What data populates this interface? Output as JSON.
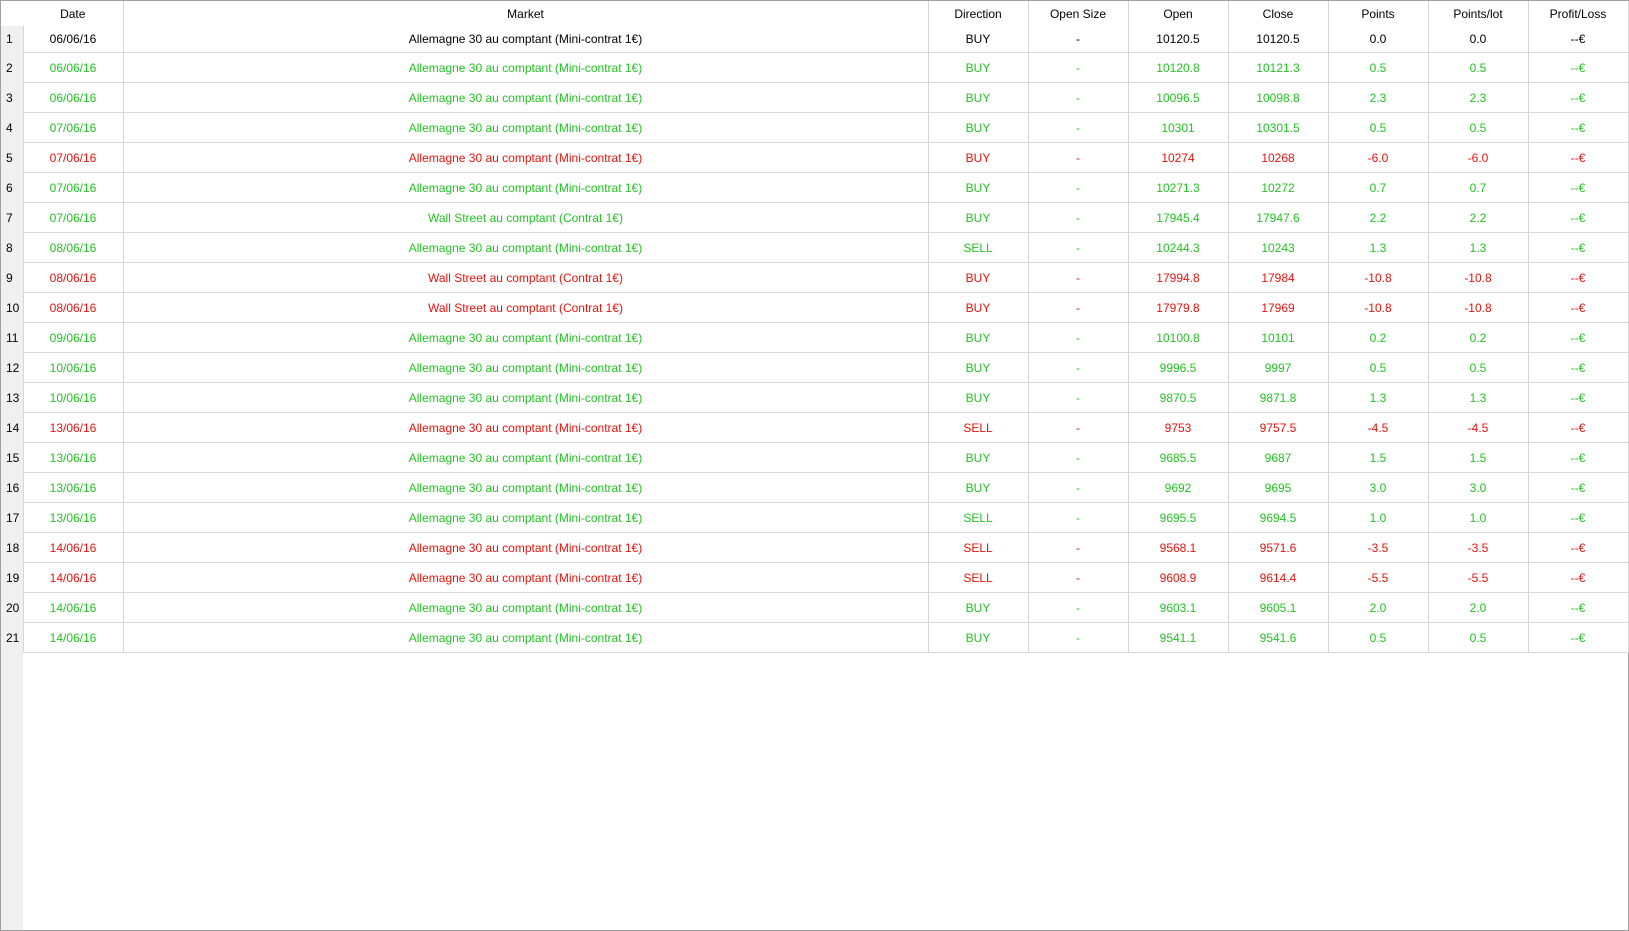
{
  "columns": [
    "Date",
    "Market",
    "Direction",
    "Open Size",
    "Open",
    "Close",
    "Points",
    "Points/lot",
    "Profit/Loss"
  ],
  "colors": {
    "neutral": "#000000",
    "win": "#22c322",
    "loss": "#e8120c"
  },
  "rows": [
    {
      "n": "1",
      "status": "neutral",
      "date": "06/06/16",
      "market": "Allemagne 30 au comptant (Mini-contrat 1€)",
      "direction": "BUY",
      "open_size": "-",
      "open": "10120.5",
      "close": "10120.5",
      "points": "0.0",
      "points_lot": "0.0",
      "pl": "--€"
    },
    {
      "n": "2",
      "status": "win",
      "date": "06/06/16",
      "market": "Allemagne 30 au comptant (Mini-contrat 1€)",
      "direction": "BUY",
      "open_size": "-",
      "open": "10120.8",
      "close": "10121.3",
      "points": "0.5",
      "points_lot": "0.5",
      "pl": "--€"
    },
    {
      "n": "3",
      "status": "win",
      "date": "06/06/16",
      "market": "Allemagne 30 au comptant (Mini-contrat 1€)",
      "direction": "BUY",
      "open_size": "-",
      "open": "10096.5",
      "close": "10098.8",
      "points": "2.3",
      "points_lot": "2.3",
      "pl": "--€"
    },
    {
      "n": "4",
      "status": "win",
      "date": "07/06/16",
      "market": "Allemagne 30 au comptant (Mini-contrat 1€)",
      "direction": "BUY",
      "open_size": "-",
      "open": "10301",
      "close": "10301.5",
      "points": "0.5",
      "points_lot": "0.5",
      "pl": "--€"
    },
    {
      "n": "5",
      "status": "loss",
      "date": "07/06/16",
      "market": "Allemagne 30 au comptant (Mini-contrat 1€)",
      "direction": "BUY",
      "open_size": "-",
      "open": "10274",
      "close": "10268",
      "points": "-6.0",
      "points_lot": "-6.0",
      "pl": "--€"
    },
    {
      "n": "6",
      "status": "win",
      "date": "07/06/16",
      "market": "Allemagne 30 au comptant (Mini-contrat 1€)",
      "direction": "BUY",
      "open_size": "-",
      "open": "10271.3",
      "close": "10272",
      "points": "0.7",
      "points_lot": "0.7",
      "pl": "--€"
    },
    {
      "n": "7",
      "status": "win",
      "date": "07/06/16",
      "market": "Wall Street au comptant (Contrat 1€)",
      "direction": "BUY",
      "open_size": "-",
      "open": "17945.4",
      "close": "17947.6",
      "points": "2.2",
      "points_lot": "2.2",
      "pl": "--€"
    },
    {
      "n": "8",
      "status": "win",
      "date": "08/06/16",
      "market": "Allemagne 30 au comptant (Mini-contrat 1€)",
      "direction": "SELL",
      "open_size": "-",
      "open": "10244.3",
      "close": "10243",
      "points": "1.3",
      "points_lot": "1.3",
      "pl": "--€"
    },
    {
      "n": "9",
      "status": "loss",
      "date": "08/06/16",
      "market": "Wall Street au comptant (Contrat 1€)",
      "direction": "BUY",
      "open_size": "-",
      "open": "17994.8",
      "close": "17984",
      "points": "-10.8",
      "points_lot": "-10.8",
      "pl": "--€"
    },
    {
      "n": "10",
      "status": "loss",
      "date": "08/06/16",
      "market": "Wall Street au comptant (Contrat 1€)",
      "direction": "BUY",
      "open_size": "-",
      "open": "17979.8",
      "close": "17969",
      "points": "-10.8",
      "points_lot": "-10.8",
      "pl": "--€"
    },
    {
      "n": "11",
      "status": "win",
      "date": "09/06/16",
      "market": "Allemagne 30 au comptant (Mini-contrat 1€)",
      "direction": "BUY",
      "open_size": "-",
      "open": "10100.8",
      "close": "10101",
      "points": "0.2",
      "points_lot": "0.2",
      "pl": "--€"
    },
    {
      "n": "12",
      "status": "win",
      "date": "10/06/16",
      "market": "Allemagne 30 au comptant (Mini-contrat 1€)",
      "direction": "BUY",
      "open_size": "-",
      "open": "9996.5",
      "close": "9997",
      "points": "0.5",
      "points_lot": "0.5",
      "pl": "--€"
    },
    {
      "n": "13",
      "status": "win",
      "date": "10/06/16",
      "market": "Allemagne 30 au comptant (Mini-contrat 1€)",
      "direction": "BUY",
      "open_size": "-",
      "open": "9870.5",
      "close": "9871.8",
      "points": "1.3",
      "points_lot": "1.3",
      "pl": "--€"
    },
    {
      "n": "14",
      "status": "loss",
      "date": "13/06/16",
      "market": "Allemagne 30 au comptant (Mini-contrat 1€)",
      "direction": "SELL",
      "open_size": "-",
      "open": "9753",
      "close": "9757.5",
      "points": "-4.5",
      "points_lot": "-4.5",
      "pl": "--€"
    },
    {
      "n": "15",
      "status": "win",
      "date": "13/06/16",
      "market": "Allemagne 30 au comptant (Mini-contrat 1€)",
      "direction": "BUY",
      "open_size": "-",
      "open": "9685.5",
      "close": "9687",
      "points": "1.5",
      "points_lot": "1.5",
      "pl": "--€"
    },
    {
      "n": "16",
      "status": "win",
      "date": "13/06/16",
      "market": "Allemagne 30 au comptant (Mini-contrat 1€)",
      "direction": "BUY",
      "open_size": "-",
      "open": "9692",
      "close": "9695",
      "points": "3.0",
      "points_lot": "3.0",
      "pl": "--€"
    },
    {
      "n": "17",
      "status": "win",
      "date": "13/06/16",
      "market": "Allemagne 30 au comptant (Mini-contrat 1€)",
      "direction": "SELL",
      "open_size": "-",
      "open": "9695.5",
      "close": "9694.5",
      "points": "1.0",
      "points_lot": "1.0",
      "pl": "--€"
    },
    {
      "n": "18",
      "status": "loss",
      "date": "14/06/16",
      "market": "Allemagne 30 au comptant (Mini-contrat 1€)",
      "direction": "SELL",
      "open_size": "-",
      "open": "9568.1",
      "close": "9571.6",
      "points": "-3.5",
      "points_lot": "-3.5",
      "pl": "--€"
    },
    {
      "n": "19",
      "status": "loss",
      "date": "14/06/16",
      "market": "Allemagne 30 au comptant (Mini-contrat 1€)",
      "direction": "SELL",
      "open_size": "-",
      "open": "9608.9",
      "close": "9614.4",
      "points": "-5.5",
      "points_lot": "-5.5",
      "pl": "--€"
    },
    {
      "n": "20",
      "status": "win",
      "date": "14/06/16",
      "market": "Allemagne 30 au comptant (Mini-contrat 1€)",
      "direction": "BUY",
      "open_size": "-",
      "open": "9603.1",
      "close": "9605.1",
      "points": "2.0",
      "points_lot": "2.0",
      "pl": "--€"
    },
    {
      "n": "21",
      "status": "win",
      "date": "14/06/16",
      "market": "Allemagne 30 au comptant (Mini-contrat 1€)",
      "direction": "BUY",
      "open_size": "-",
      "open": "9541.1",
      "close": "9541.6",
      "points": "0.5",
      "points_lot": "0.5",
      "pl": "--€"
    }
  ]
}
